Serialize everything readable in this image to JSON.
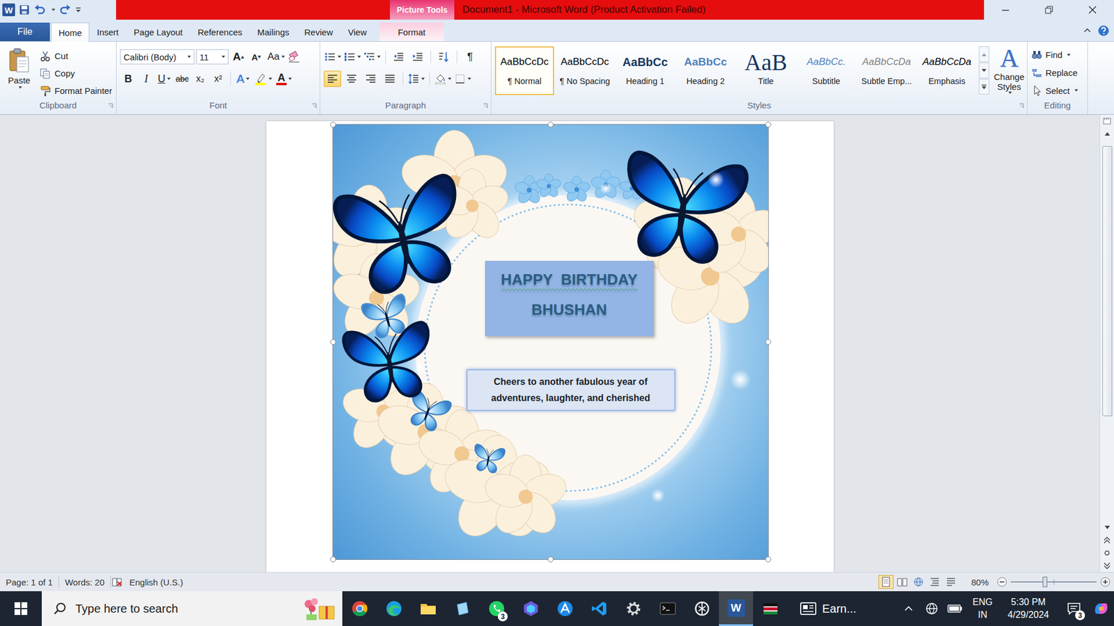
{
  "title_bar": {
    "logo": "W",
    "contextual_group": "Picture Tools",
    "title": "Document1 - Microsoft Word (Product Activation Failed)"
  },
  "tabs": [
    {
      "label": "File",
      "selected": false,
      "kind": "file"
    },
    {
      "label": "Home",
      "selected": true,
      "kind": "tab"
    },
    {
      "label": "Insert",
      "selected": false,
      "kind": "tab"
    },
    {
      "label": "Page Layout",
      "selected": false,
      "kind": "tab"
    },
    {
      "label": "References",
      "selected": false,
      "kind": "tab"
    },
    {
      "label": "Mailings",
      "selected": false,
      "kind": "tab"
    },
    {
      "label": "Review",
      "selected": false,
      "kind": "tab"
    },
    {
      "label": "View",
      "selected": false,
      "kind": "tab"
    },
    {
      "label": "Format",
      "selected": false,
      "kind": "contextual"
    }
  ],
  "clipboard": {
    "label": "Clipboard",
    "paste": "Paste",
    "actions": [
      {
        "label": "Cut",
        "kind": "cut"
      },
      {
        "label": "Copy",
        "kind": "copy"
      },
      {
        "label": "Format Painter",
        "kind": "painter"
      }
    ]
  },
  "font": {
    "label": "Font",
    "name": "Calibri (Body)",
    "size": "11",
    "grow": "A",
    "shrink": "A",
    "change_case": "Aa",
    "effects": "A",
    "color": "A",
    "format_buttons": [
      {
        "label": "B",
        "kind": "bold"
      },
      {
        "label": "I",
        "kind": "italic"
      },
      {
        "label": "U",
        "kind": "underline"
      },
      {
        "label": "abc",
        "kind": "strike"
      },
      {
        "label": "x₂",
        "kind": "sub"
      },
      {
        "label": "x²",
        "kind": "sup"
      }
    ]
  },
  "paragraph": {
    "label": "Paragraph",
    "show_marks": "¶",
    "alignments": [
      {
        "kind": "left",
        "selected": true
      },
      {
        "kind": "center",
        "selected": false
      },
      {
        "kind": "right",
        "selected": false
      },
      {
        "kind": "justify",
        "selected": false
      }
    ]
  },
  "styles": {
    "label": "Styles",
    "change_styles": "Change Styles",
    "change_styles_icon": "A",
    "items": [
      {
        "preview": "AaBbCcDc",
        "label": "¶ Normal",
        "kind": "normal",
        "selected": true
      },
      {
        "preview": "AaBbCcDc",
        "label": "¶ No Spacing",
        "kind": "normal",
        "selected": false
      },
      {
        "preview": "AaBbCc",
        "label": "Heading 1",
        "kind": "heading1",
        "selected": false
      },
      {
        "preview": "AaBbCc",
        "label": "Heading 2",
        "kind": "heading2",
        "selected": false
      },
      {
        "preview": "AaB",
        "label": "Title",
        "kind": "title",
        "selected": false
      },
      {
        "preview": "AaBbCc.",
        "label": "Subtitle",
        "kind": "subtitle",
        "selected": false
      },
      {
        "preview": "AaBbCcDa",
        "label": "Subtle Emp...",
        "kind": "subtle",
        "selected": false
      },
      {
        "preview": "AaBbCcDa",
        "label": "Emphasis",
        "kind": "emphasis",
        "selected": false
      }
    ]
  },
  "editing": {
    "label": "Editing",
    "items": [
      {
        "label": "Find",
        "kind": "find"
      },
      {
        "label": "Replace",
        "kind": "replace"
      },
      {
        "label": "Select",
        "kind": "select"
      }
    ]
  },
  "document": {
    "picture_selected": true,
    "heading_line1": "HAPPY  BIRTHDAY",
    "heading_line2": "BHUSHAN",
    "message": "Cheers to another fabulous year of adventures, laughter, and cherished"
  },
  "scrollbar": {
    "level": 0.72
  },
  "status_bar": {
    "page": "Page: 1 of 1",
    "words": "Words: 20",
    "language": "English (U.S.)",
    "zoom": "80%",
    "zoom_level": 0.4,
    "views": [
      {
        "kind": "print",
        "selected": true
      },
      {
        "kind": "reading",
        "selected": false
      },
      {
        "kind": "web",
        "selected": false
      },
      {
        "kind": "outline",
        "selected": false
      },
      {
        "kind": "draft",
        "selected": false
      }
    ]
  },
  "taskbar": {
    "search_placeholder": "Type here to search",
    "apps": [
      {
        "kind": "chrome",
        "active": false
      },
      {
        "kind": "edge",
        "active": false
      },
      {
        "kind": "explorer",
        "active": false
      },
      {
        "kind": "notes",
        "active": false
      },
      {
        "kind": "whatsapp",
        "active": false,
        "badge": "3"
      },
      {
        "kind": "hex",
        "active": false
      },
      {
        "kind": "azure",
        "active": false
      },
      {
        "kind": "vscode",
        "active": false
      },
      {
        "kind": "settings",
        "active": false
      },
      {
        "kind": "terminal",
        "active": false
      },
      {
        "kind": "chatgpt",
        "active": false
      },
      {
        "kind": "word",
        "active": true,
        "label": "W"
      },
      {
        "kind": "flag",
        "active": false
      }
    ],
    "widget": "Earn...",
    "language": "ENG",
    "region": "IN",
    "time": "5:30 PM",
    "date": "4/29/2024",
    "notifications": "3"
  }
}
